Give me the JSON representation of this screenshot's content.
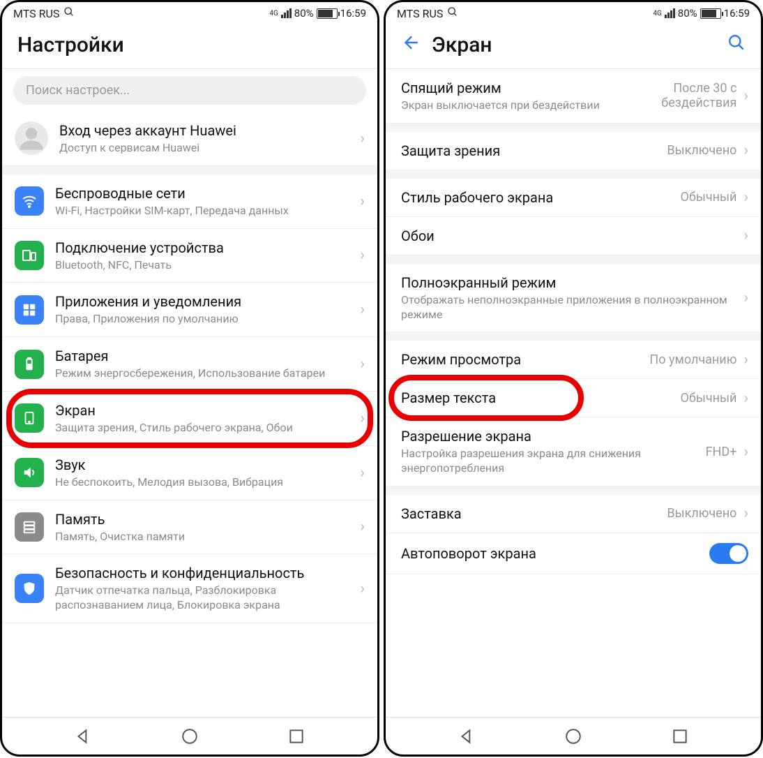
{
  "status": {
    "carrier": "MTS RUS",
    "net": "4G",
    "battery": "80%",
    "time": "16:59"
  },
  "left": {
    "title": "Настройки",
    "searchPlaceholder": "Поиск настроек...",
    "account": {
      "title": "Вход через аккаунт Huawei",
      "sub": "Доступ к сервисам Huawei"
    },
    "items": [
      {
        "title": "Беспроводные сети",
        "sub": "Wi-Fi, Настройки SIM-карт, Передача данных",
        "color": "#3a82f7",
        "icon": "wifi"
      },
      {
        "title": "Подключение устройства",
        "sub": "Bluetooth, NFC, Печать",
        "color": "#22b14c",
        "icon": "device"
      },
      {
        "title": "Приложения и уведомления",
        "sub": "Права, Приложения по умолчанию",
        "color": "#3a82f7",
        "icon": "apps"
      },
      {
        "title": "Батарея",
        "sub": "Режим энергосбережения, Использование батареи",
        "color": "#22b14c",
        "icon": "battery"
      },
      {
        "title": "Экран",
        "sub": "Защита зрения, Стиль рабочего экрана, Обои",
        "color": "#22b14c",
        "icon": "display",
        "highlight": true
      },
      {
        "title": "Звук",
        "sub": "Не беспокоить, Мелодия вызова, Вибрация",
        "color": "#22b14c",
        "icon": "sound"
      },
      {
        "title": "Память",
        "sub": "Память, Очистка памяти",
        "color": "#8a8a8a",
        "icon": "storage"
      },
      {
        "title": "Безопасность и конфиденциальность",
        "sub": "Датчик отпечатка пальца, Разблокировка распознаванием лица, Блокировка экрана",
        "color": "#3a82f7",
        "icon": "security"
      }
    ]
  },
  "right": {
    "title": "Экран",
    "groups": [
      [
        {
          "title": "Спящий режим",
          "sub": "Экран выключается при бездействии",
          "value": "После 30 с бездействия"
        }
      ],
      [
        {
          "title": "Защита зрения",
          "value": "Выключено"
        }
      ],
      [
        {
          "title": "Стиль рабочего экрана",
          "value": "Обычный"
        },
        {
          "title": "Обои",
          "value": ""
        }
      ],
      [
        {
          "title": "Полноэкранный режим",
          "sub": "Отображать неполноэкранные приложения в полноэкранном режиме"
        }
      ],
      [
        {
          "title": "Режим просмотра",
          "value": "По умолчанию"
        },
        {
          "title": "Размер текста",
          "value": "Обычный",
          "highlight": true
        },
        {
          "title": "Разрешение экрана",
          "sub": "Настройка разрешения экрана для снижения энергопотребления",
          "value": "FHD+"
        }
      ],
      [
        {
          "title": "Заставка",
          "value": "Выключено"
        },
        {
          "title": "Автоповорот экрана",
          "toggle": true
        }
      ]
    ]
  }
}
